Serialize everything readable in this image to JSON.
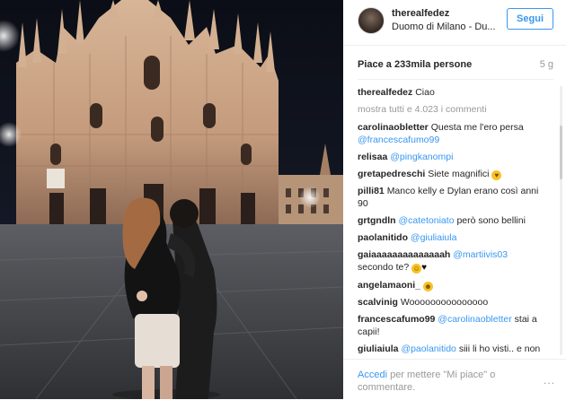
{
  "colors": {
    "accent": "#3897f0",
    "text": "#262626",
    "muted": "#999999"
  },
  "header": {
    "username": "therealfedez",
    "location": "Duomo di Milano - Du...",
    "follow_label": "Segui"
  },
  "likes": "Piace a 233mila persone",
  "age": "5 g",
  "caption": {
    "user": "therealfedez",
    "text": "Ciao"
  },
  "show_all": "mostra tutti e 4.023 i commenti",
  "comments": [
    {
      "user": "carolinaobletter",
      "text": "Questa me l'ero persa",
      "mention": "@francescafumo99",
      "tail": ""
    },
    {
      "user": "relisaa",
      "text": "",
      "mention": "@pingkanompi",
      "tail": ""
    },
    {
      "user": "gretapedreschi",
      "text": "Siete magnifici",
      "mention": "",
      "tail": ""
    },
    {
      "user": "pilli81",
      "text": "Manco kelly e Dylan erano così anni 90",
      "mention": "",
      "tail": ""
    },
    {
      "user": "grtgndln",
      "text": "",
      "mention": "@catetoniato",
      "tail": "però sono bellini"
    },
    {
      "user": "paolanitido",
      "text": "",
      "mention": "@giuliaiula",
      "tail": ""
    },
    {
      "user": "gaiaaaaaaaaaaaaaah",
      "text": "",
      "mention": "@martiivis03",
      "tail": "secondo te?"
    },
    {
      "user": "angelamaoni_",
      "text": "",
      "mention": "",
      "tail": ""
    },
    {
      "user": "scalvinig",
      "text": "Wooooooooooooooo",
      "mention": "",
      "tail": ""
    },
    {
      "user": "francescafumo99",
      "text": "",
      "mention": "@carolinaobletter",
      "tail": "stai a capii!"
    },
    {
      "user": "giuliaiula",
      "text": "",
      "mention": "@paolanitido",
      "tail": "siii li ho visti.. e non mi piacciono"
    }
  ],
  "footer": {
    "link": "Accedi",
    "text": "per mettere \"Mi piace\" o commentare.",
    "more": "..."
  }
}
